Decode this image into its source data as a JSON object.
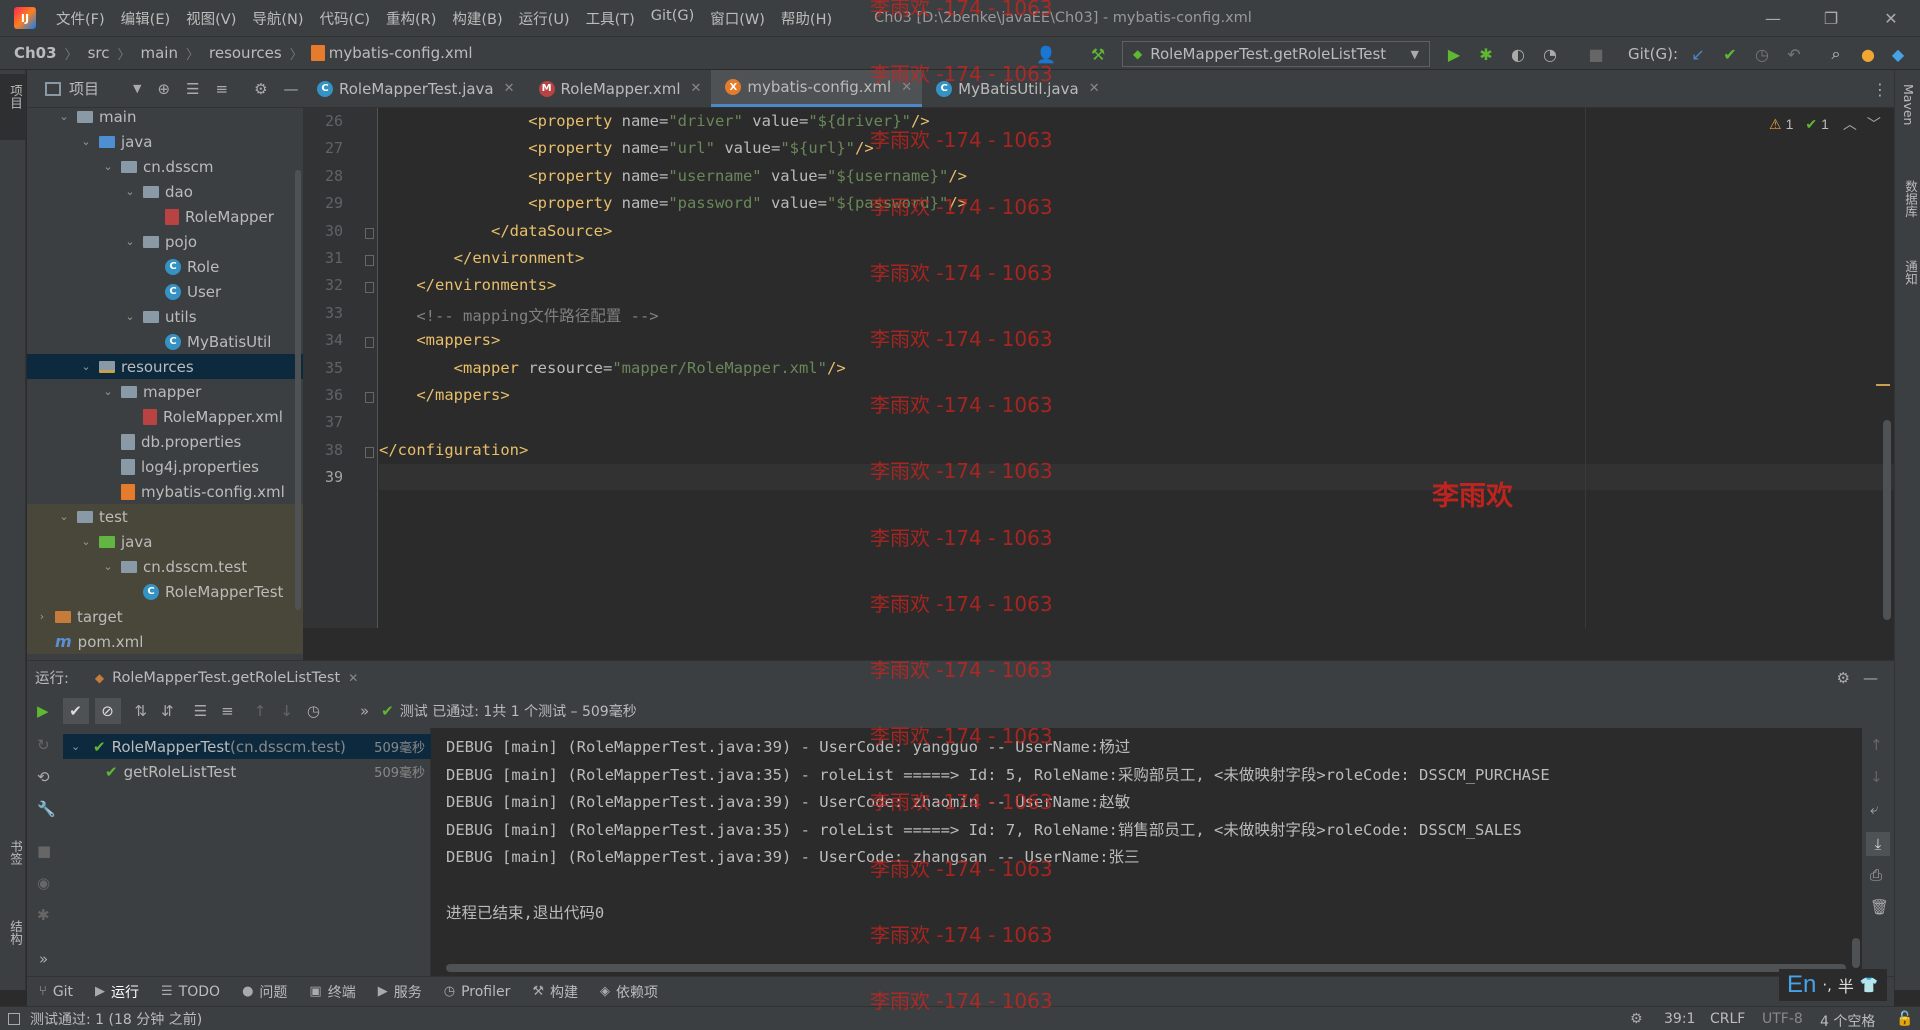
{
  "titlebar": {
    "menus": [
      "文件(F)",
      "编辑(E)",
      "视图(V)",
      "导航(N)",
      "代码(C)",
      "重构(R)",
      "构建(B)",
      "运行(U)",
      "工具(T)",
      "Git(G)",
      "窗口(W)",
      "帮助(H)"
    ],
    "window_title": "Ch03 [D:\\2benke\\javaEE\\Ch03] - mybatis-config.xml"
  },
  "navbar": {
    "crumbs": [
      "Ch03",
      "src",
      "main",
      "resources",
      "mybatis-config.xml"
    ],
    "run_config": "RoleMapperTest.getRoleListTest",
    "git_label": "Git(G):"
  },
  "project": {
    "title": "项目",
    "tree": [
      {
        "label": "main",
        "kind": "folder",
        "level": 0,
        "open": true
      },
      {
        "label": "java",
        "kind": "folder-blue",
        "level": 1,
        "open": true
      },
      {
        "label": "cn.dsscm",
        "kind": "folder",
        "level": 2,
        "open": true
      },
      {
        "label": "dao",
        "kind": "folder",
        "level": 3,
        "open": true
      },
      {
        "label": "RoleMapper",
        "kind": "bird",
        "level": 4
      },
      {
        "label": "pojo",
        "kind": "folder",
        "level": 3,
        "open": true
      },
      {
        "label": "Role",
        "kind": "class",
        "level": 4
      },
      {
        "label": "User",
        "kind": "class",
        "level": 4
      },
      {
        "label": "utils",
        "kind": "folder",
        "level": 3,
        "open": true
      },
      {
        "label": "MyBatisUtil",
        "kind": "class",
        "level": 4
      },
      {
        "label": "resources",
        "kind": "folder-res",
        "level": 1,
        "open": true,
        "selected": true
      },
      {
        "label": "mapper",
        "kind": "folder",
        "level": 2,
        "open": true
      },
      {
        "label": "RoleMapper.xml",
        "kind": "bird",
        "level": 3
      },
      {
        "label": "db.properties",
        "kind": "prop",
        "level": 2
      },
      {
        "label": "log4j.properties",
        "kind": "prop",
        "level": 2
      },
      {
        "label": "mybatis-config.xml",
        "kind": "xml",
        "level": 2
      },
      {
        "label": "test",
        "kind": "folder",
        "level": 0,
        "open": true,
        "test": true
      },
      {
        "label": "java",
        "kind": "folder-green",
        "level": 1,
        "open": true,
        "test": true
      },
      {
        "label": "cn.dsscm.test",
        "kind": "folder",
        "level": 2,
        "open": true,
        "test": true
      },
      {
        "label": "RoleMapperTest",
        "kind": "class-test",
        "level": 3,
        "test": true
      },
      {
        "label": "target",
        "kind": "folder-orange",
        "level": -1,
        "open": false,
        "test": true
      },
      {
        "label": "pom.xml",
        "kind": "maven",
        "level": -1,
        "test": true
      }
    ]
  },
  "tabs": [
    {
      "label": "RoleMapperTest.java",
      "icon": "C",
      "color": "#3592c4",
      "active": false
    },
    {
      "label": "RoleMapper.xml",
      "icon": "M",
      "color": "#b94343",
      "active": false
    },
    {
      "label": "mybatis-config.xml",
      "icon": "X",
      "color": "#e57c2b",
      "active": true
    },
    {
      "label": "MyBatisUtil.java",
      "icon": "C",
      "color": "#3592c4",
      "active": false
    }
  ],
  "editor": {
    "line_numbers": [
      "26",
      "27",
      "28",
      "29",
      "30",
      "31",
      "32",
      "33",
      "34",
      "35",
      "36",
      "37",
      "38",
      "39"
    ],
    "inspections": {
      "warnings": "1",
      "ok": "1"
    },
    "lines": [
      [
        {
          "t": "                <",
          "c": "tag"
        },
        {
          "t": "property",
          "c": "tag"
        },
        {
          "t": " name",
          "c": "attr"
        },
        {
          "t": "=",
          "c": "attr"
        },
        {
          "t": "\"driver\"",
          "c": "val"
        },
        {
          "t": " value",
          "c": "attr"
        },
        {
          "t": "=",
          "c": "attr"
        },
        {
          "t": "\"${driver}\"",
          "c": "val"
        },
        {
          "t": "/>",
          "c": "tag"
        }
      ],
      [
        {
          "t": "                <",
          "c": "tag"
        },
        {
          "t": "property",
          "c": "tag"
        },
        {
          "t": " name",
          "c": "attr"
        },
        {
          "t": "=",
          "c": "attr"
        },
        {
          "t": "\"url\"",
          "c": "val"
        },
        {
          "t": " value",
          "c": "attr"
        },
        {
          "t": "=",
          "c": "attr"
        },
        {
          "t": "\"${url}\"",
          "c": "val"
        },
        {
          "t": "/>",
          "c": "tag"
        }
      ],
      [
        {
          "t": "                <",
          "c": "tag"
        },
        {
          "t": "property",
          "c": "tag"
        },
        {
          "t": " name",
          "c": "attr"
        },
        {
          "t": "=",
          "c": "attr"
        },
        {
          "t": "\"username\"",
          "c": "val"
        },
        {
          "t": " value",
          "c": "attr"
        },
        {
          "t": "=",
          "c": "attr"
        },
        {
          "t": "\"${username}\"",
          "c": "val"
        },
        {
          "t": "/>",
          "c": "tag"
        }
      ],
      [
        {
          "t": "                <",
          "c": "tag"
        },
        {
          "t": "property",
          "c": "tag"
        },
        {
          "t": " name",
          "c": "attr"
        },
        {
          "t": "=",
          "c": "attr"
        },
        {
          "t": "\"password\"",
          "c": "val"
        },
        {
          "t": " value",
          "c": "attr"
        },
        {
          "t": "=",
          "c": "attr"
        },
        {
          "t": "\"${password}\"",
          "c": "val"
        },
        {
          "t": "/>",
          "c": "tag"
        }
      ],
      [
        {
          "t": "            </dataSource>",
          "c": "tag"
        }
      ],
      [
        {
          "t": "        </environment>",
          "c": "tag"
        }
      ],
      [
        {
          "t": "    </environments>",
          "c": "tag"
        }
      ],
      [
        {
          "t": "    <!-- mapping文件路径配置 -->",
          "c": "cmt"
        }
      ],
      [
        {
          "t": "    <mappers>",
          "c": "tag"
        }
      ],
      [
        {
          "t": "        <",
          "c": "tag"
        },
        {
          "t": "mapper",
          "c": "tag"
        },
        {
          "t": " resource",
          "c": "attr"
        },
        {
          "t": "=",
          "c": "attr"
        },
        {
          "t": "\"mapper/RoleMapper.xml\"",
          "c": "val"
        },
        {
          "t": "/>",
          "c": "tag"
        }
      ],
      [
        {
          "t": "    </mappers>",
          "c": "tag"
        }
      ],
      [
        {
          "t": "",
          "c": "tag"
        }
      ],
      [
        {
          "t": "</configuration>",
          "c": "tag"
        }
      ],
      [
        {
          "t": "",
          "c": "tag"
        }
      ]
    ],
    "watermark_text": "李雨欢 -174 - 1063",
    "watermark_name": "李雨欢"
  },
  "run": {
    "label": "运行:",
    "config_tab": "RoleMapperTest.getRoleListTest",
    "status": "测试 已通过: 1共 1 个测试 – 509毫秒",
    "tests": [
      {
        "name": "RoleMapperTest",
        "pkg": " (cn.dsscm.test)",
        "duration": "509毫秒",
        "level": 0
      },
      {
        "name": "getRoleListTest",
        "pkg": "",
        "duration": "509毫秒",
        "level": 1
      }
    ],
    "console": [
      "DEBUG [main] (RoleMapperTest.java:39) - UserCode: yangguo -- UserName:杨过",
      "DEBUG [main] (RoleMapperTest.java:35) - roleList =====> Id: 5, RoleName:采购部员工, <未做映射字段>roleCode: DSSCM_PURCHASE",
      "DEBUG [main] (RoleMapperTest.java:39) - UserCode: zhaomin -- UserName:赵敏",
      "DEBUG [main] (RoleMapperTest.java:35) - roleList =====> Id: 7, RoleName:销售部员工, <未做映射字段>roleCode: DSSCM_SALES",
      "DEBUG [main] (RoleMapperTest.java:39) - UserCode: zhangsan -- UserName:张三",
      "",
      "进程已结束,退出代码0"
    ]
  },
  "tool_tabs": [
    {
      "label": "Git",
      "icon": "⑂"
    },
    {
      "label": "运行",
      "icon": "▶",
      "active": true
    },
    {
      "label": "TODO",
      "icon": "☰"
    },
    {
      "label": "问题",
      "icon": "●"
    },
    {
      "label": "终端",
      "icon": "▣"
    },
    {
      "label": "服务",
      "icon": "▶"
    },
    {
      "label": "Profiler",
      "icon": "◷"
    },
    {
      "label": "构建",
      "icon": "⚒"
    },
    {
      "label": "依赖项",
      "icon": "◈"
    }
  ],
  "statusbar": {
    "message": "测试通过: 1 (18 分钟 之前)",
    "position": "39:1",
    "line_sep": "CRLF",
    "encoding": "UTF-8",
    "indent": "4 个空格"
  },
  "side_labels": {
    "left_top": "项目",
    "left_bookmarks": "书签",
    "left_structure": "结构",
    "right_maven": "Maven",
    "right_db": "数据库",
    "right_notify": "通知"
  },
  "ime": {
    "lang": "En",
    "mode": "半"
  }
}
